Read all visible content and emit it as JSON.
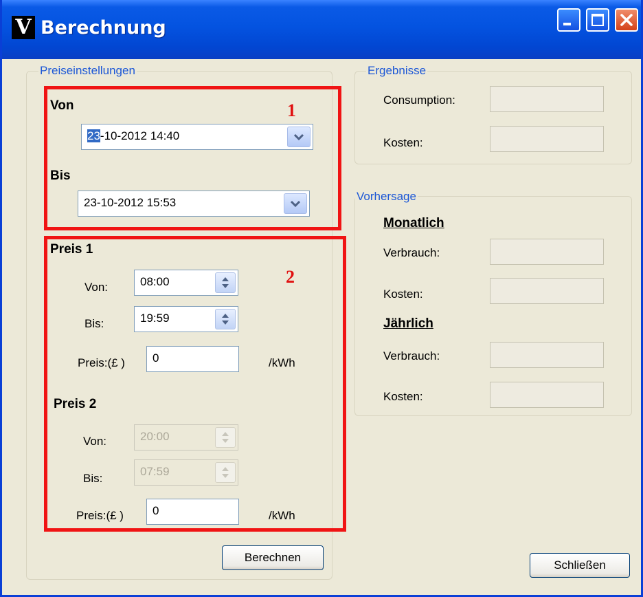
{
  "window": {
    "title": "Berechnung",
    "icon": "v-logo-icon"
  },
  "preise": {
    "legend": "Preiseinstellungen",
    "von_title": "Von",
    "von_value_sel": "23",
    "von_value_rest": "-10-2012 14:40",
    "bis_title": "Bis",
    "bis_value": "23-10-2012 15:53",
    "preis1": {
      "title": "Preis 1",
      "von_label": "Von:",
      "von_value": "08:00",
      "bis_label": "Bis:",
      "bis_value": "19:59",
      "preis_label": "Preis:(£ )",
      "preis_value": "0",
      "unit": "/kWh"
    },
    "preis2": {
      "title": "Preis 2",
      "von_label": "Von:",
      "von_value": "20:00",
      "bis_label": "Bis:",
      "bis_value": "07:59",
      "preis_label": "Preis:(£ )",
      "preis_value": "0",
      "unit": "/kWh"
    },
    "berechnen": "Berechnen"
  },
  "ergebnisse": {
    "legend": "Ergebnisse",
    "consumption_label": "Consumption:",
    "kosten_label": "Kosten:"
  },
  "vorhersage": {
    "legend": "Vorhersage",
    "monatlich": "Monatlich",
    "m_verbrauch": "Verbrauch:",
    "m_kosten": "Kosten:",
    "jaehrlich": "Jährlich",
    "j_verbrauch": "Verbrauch:",
    "j_kosten": "Kosten:"
  },
  "schliessen": "Schließen",
  "annotations": {
    "n1": "1",
    "n2": "2"
  },
  "colors": {
    "accent": "#0453e0",
    "highlight": "#f01414",
    "legend": "#1c57d6"
  }
}
